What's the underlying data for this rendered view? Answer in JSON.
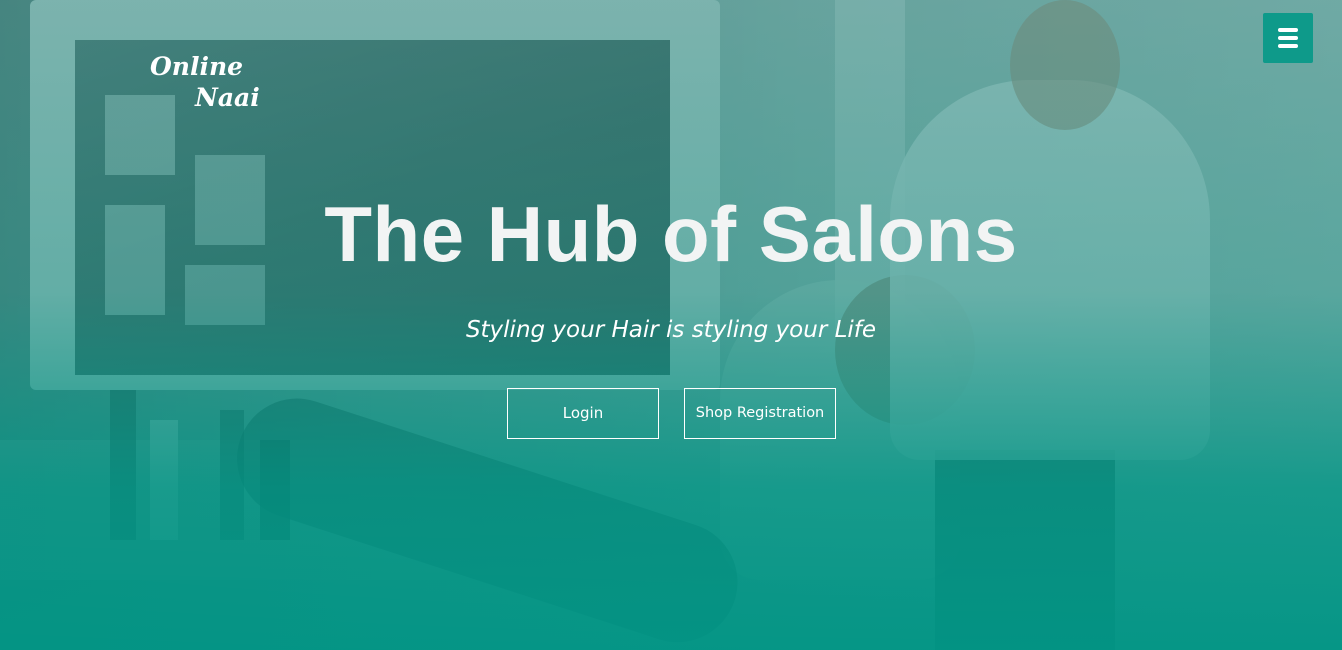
{
  "brand": {
    "line1": "Online",
    "line2": "Naai"
  },
  "header": {
    "menu_icon": "hamburger-menu-icon",
    "menu_color": "#0e9a8a"
  },
  "hero": {
    "title": "The Hub of Salons",
    "tagline": "Styling your Hair is styling your Life",
    "overlay_color": "#009482"
  },
  "actions": {
    "login_label": "Login",
    "shop_registration_label": "Shop Registration"
  }
}
